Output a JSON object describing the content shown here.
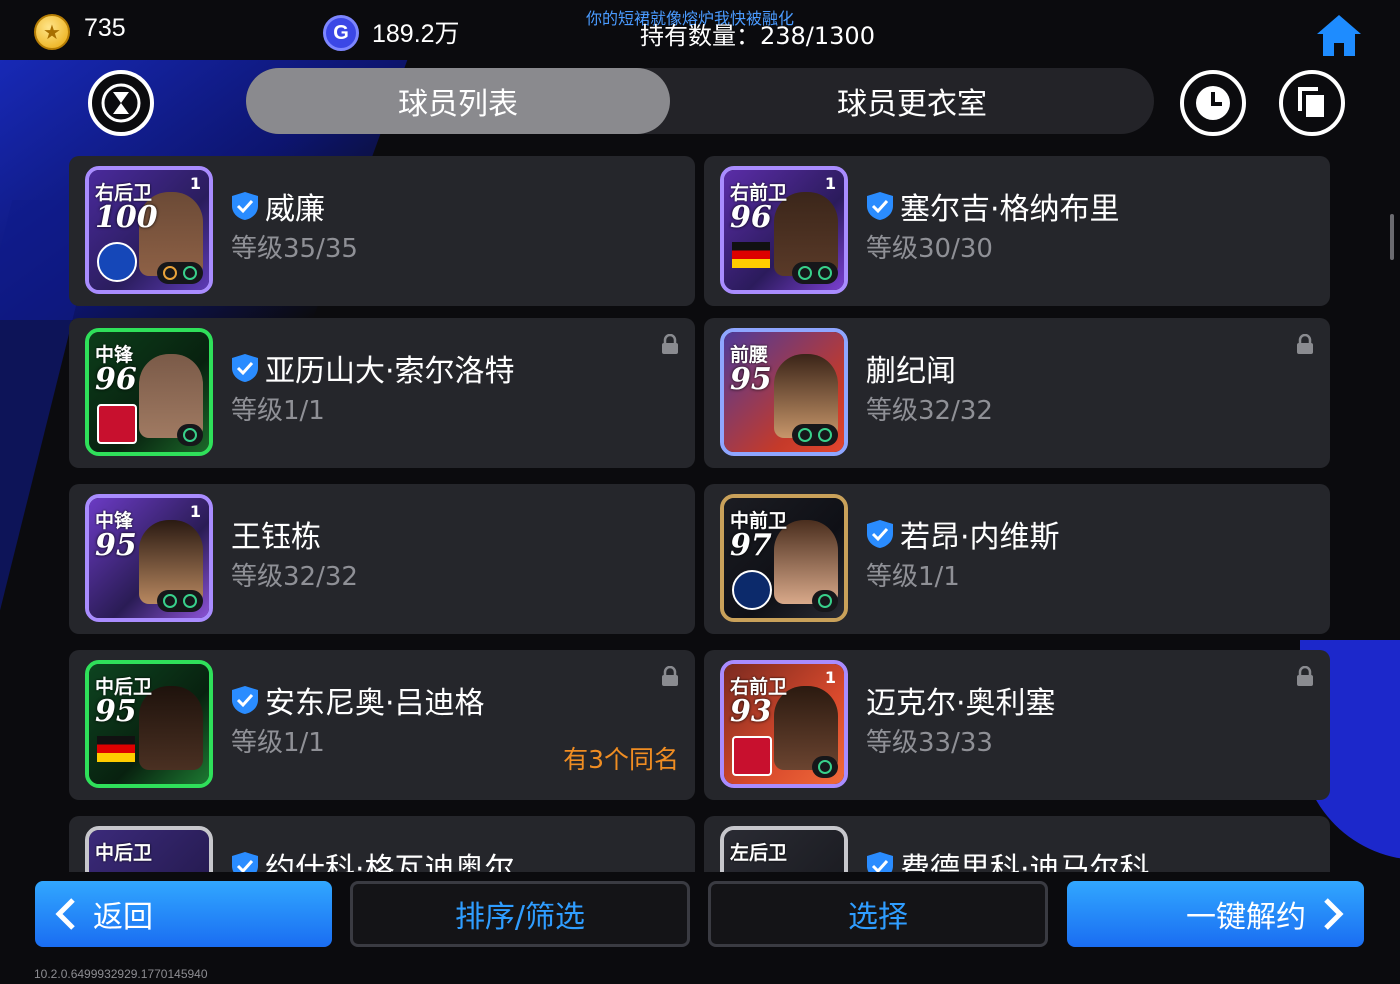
{
  "currency": {
    "coins": "735",
    "gp": "189.2万",
    "gp_icon_letter": "G"
  },
  "marquee": "你的短裙就像熔炉我快被融化",
  "holdings": "持有数量：238/1300",
  "tabs": [
    {
      "label": "球员列表",
      "active": true
    },
    {
      "label": "球员更衣室",
      "active": false
    }
  ],
  "players": [
    {
      "name": "威廉",
      "level": "等级35/35",
      "position": "右后卫",
      "rating": "100",
      "badge": "1",
      "verified": true,
      "locked": false
    },
    {
      "name": "塞尔吉·格纳布里",
      "level": "等级30/30",
      "position": "右前卫",
      "rating": "96",
      "badge": "1",
      "verified": true,
      "locked": false
    },
    {
      "name": "亚历山大·索尔洛特",
      "level": "等级1/1",
      "position": "中锋",
      "rating": "96",
      "badge": "",
      "verified": true,
      "locked": true
    },
    {
      "name": "蒯纪闻",
      "level": "等级32/32",
      "position": "前腰",
      "rating": "95",
      "badge": "",
      "verified": false,
      "locked": true
    },
    {
      "name": "王钰栋",
      "level": "等级32/32",
      "position": "中锋",
      "rating": "95",
      "badge": "1",
      "verified": false,
      "locked": false
    },
    {
      "name": "若昂·内维斯",
      "level": "等级1/1",
      "position": "中前卫",
      "rating": "97",
      "badge": "",
      "verified": true,
      "locked": false
    },
    {
      "name": "安东尼奥·吕迪格",
      "level": "等级1/1",
      "position": "中后卫",
      "rating": "95",
      "badge": "",
      "verified": true,
      "locked": true,
      "note": "有3个同名"
    },
    {
      "name": "迈克尔·奥利塞",
      "level": "等级33/33",
      "position": "右前卫",
      "rating": "93",
      "badge": "1",
      "verified": false,
      "locked": true
    },
    {
      "name": "约什科·格瓦迪奥尔",
      "level": "",
      "position": "中后卫",
      "rating": "",
      "badge": "",
      "verified": true,
      "locked": false
    },
    {
      "name": "费德里科·迪马尔科",
      "level": "",
      "position": "左后卫",
      "rating": "",
      "badge": "",
      "verified": true,
      "locked": false
    }
  ],
  "bottom": {
    "back": "返回",
    "sort": "排序/筛选",
    "select": "选择",
    "release": "一键解约"
  },
  "version": "10.2.0.6499932929.1770145940",
  "colors": {
    "accent_blue": "#1a6df2",
    "orange": "#f08d22",
    "card_bg": "#25262b"
  }
}
